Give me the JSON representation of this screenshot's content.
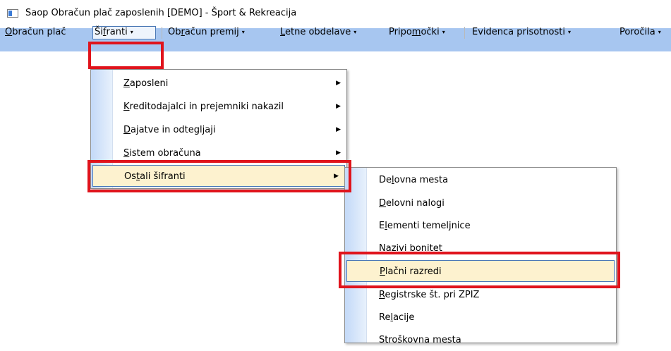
{
  "window": {
    "title": "Saop Obračun plač zaposlenih  [DEMO] - Šport & Rekreacija",
    "icon": "app-window-icon"
  },
  "menubar": {
    "items": [
      {
        "pre": "",
        "u": "O",
        "post": "bračun plač",
        "arrow": ""
      },
      {
        "pre": "Ši",
        "u": "f",
        "post": "ranti",
        "arrow": "▾"
      },
      {
        "pre": "Ob",
        "u": "r",
        "post": "ačun premij",
        "arrow": "▾"
      },
      {
        "pre": "",
        "u": "L",
        "post": "etne obdelave",
        "arrow": "▾"
      },
      {
        "pre": "Pripo",
        "u": "m",
        "post": "očki",
        "arrow": "▾"
      },
      {
        "pre": "Evidenca prisotnosti",
        "u": "",
        "post": "",
        "arrow": "▾"
      },
      {
        "pre": "Poročila",
        "u": "",
        "post": "",
        "arrow": "▾"
      }
    ]
  },
  "sifranti_menu": {
    "items": [
      {
        "pre": "",
        "u": "Z",
        "post": "aposleni",
        "arrow": "▶"
      },
      {
        "pre": "",
        "u": "K",
        "post": "reditodajalci in prejemniki nakazil",
        "arrow": "▶"
      },
      {
        "pre": "",
        "u": "D",
        "post": "ajatve in odtegljaji",
        "arrow": "▶"
      },
      {
        "pre": "",
        "u": "S",
        "post": "istem obračuna",
        "arrow": "▶"
      },
      {
        "pre": "Os",
        "u": "t",
        "post": "ali šifranti",
        "arrow": "▶"
      }
    ]
  },
  "ostali_menu": {
    "items": [
      {
        "pre": "De",
        "u": "l",
        "post": "ovna mesta"
      },
      {
        "pre": "",
        "u": "D",
        "post": "elovni nalogi"
      },
      {
        "pre": "E",
        "u": "l",
        "post": "ementi temeljnice"
      },
      {
        "pre": "",
        "u": "N",
        "post": "azivi bonitet"
      },
      {
        "pre": "",
        "u": "P",
        "post": "lačni razredi"
      },
      {
        "pre": "",
        "u": "R",
        "post": "egistrske št. pri ZPIZ"
      },
      {
        "pre": "Re",
        "u": "l",
        "post": "acije"
      },
      {
        "pre": "Stroškovna mesta",
        "u": "",
        "post": ""
      }
    ]
  },
  "colors": {
    "menubar_strip": "#a7c6f0",
    "highlight_fill": "#fdf2cf",
    "highlight_border": "#4776b8",
    "annotation_red": "#e0141c"
  }
}
